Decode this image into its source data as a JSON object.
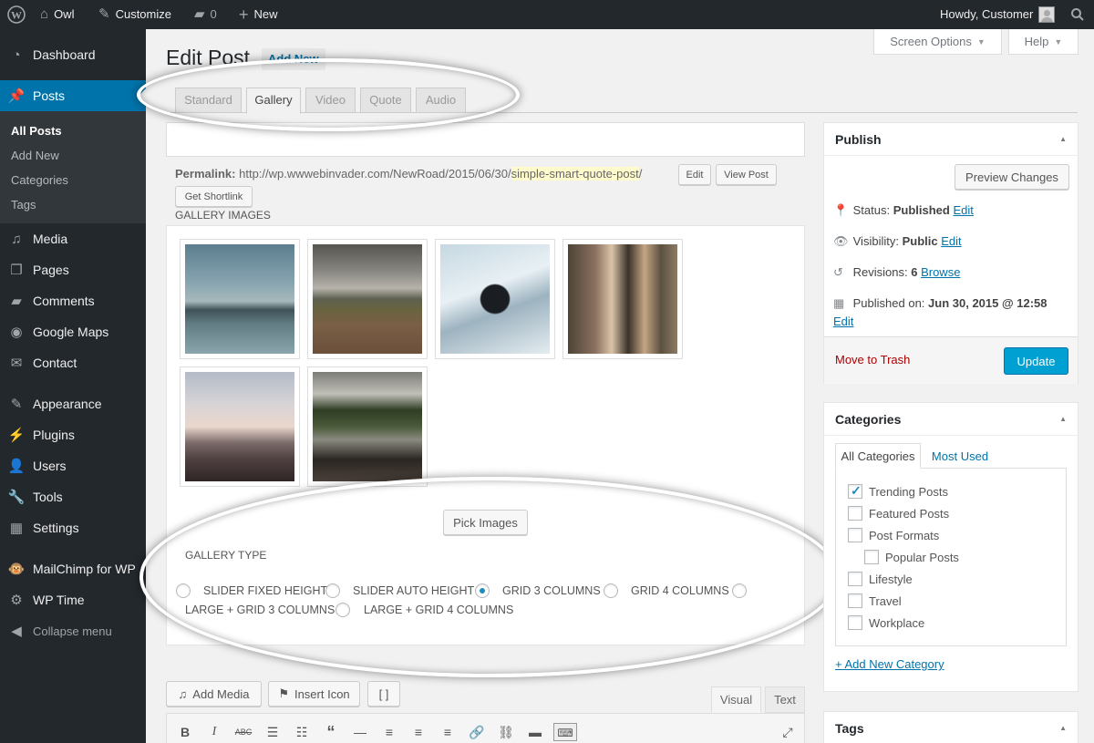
{
  "adminbar": {
    "site_name": "Owl",
    "customize": "Customize",
    "comments_count": "0",
    "new_label": "New",
    "howdy": "Howdy, Customer"
  },
  "sidebar": {
    "items": [
      {
        "label": "Dashboard",
        "icon": "dashboard-icon"
      },
      {
        "label": "Posts",
        "icon": "pushpin-icon"
      },
      {
        "label": "Media",
        "icon": "media-icon"
      },
      {
        "label": "Pages",
        "icon": "pages-icon"
      },
      {
        "label": "Comments",
        "icon": "comments-icon"
      },
      {
        "label": "Google Maps",
        "icon": "map-icon"
      },
      {
        "label": "Contact",
        "icon": "mail-icon"
      },
      {
        "label": "Appearance",
        "icon": "brush-icon"
      },
      {
        "label": "Plugins",
        "icon": "plugin-icon"
      },
      {
        "label": "Users",
        "icon": "user-icon"
      },
      {
        "label": "Tools",
        "icon": "wrench-icon"
      },
      {
        "label": "Settings",
        "icon": "settings-icon"
      },
      {
        "label": "MailChimp for WP",
        "icon": "mailchimp-icon"
      },
      {
        "label": "WP Time",
        "icon": "gear-icon"
      }
    ],
    "submenu": [
      "All Posts",
      "Add New",
      "Categories",
      "Tags"
    ],
    "collapse": "Collapse menu"
  },
  "screen_options": "Screen Options",
  "help": "Help",
  "page": {
    "title": "Edit Post",
    "add_new": "Add New"
  },
  "format_tabs": [
    "Standard",
    "Gallery",
    "Video",
    "Quote",
    "Audio"
  ],
  "active_format": "Gallery",
  "permalink": {
    "label": "Permalink:",
    "base": "http://wp.wwwebinvader.com/NewRoad/2015/06/30/",
    "slug": "simple-smart-quote-post",
    "trail": "/",
    "edit": "Edit",
    "view_post": "View Post",
    "get_shortlink": "Get Shortlink"
  },
  "gallery": {
    "label": "GALLERY IMAGES",
    "pick_images": "Pick Images",
    "type_label": "GALLERY TYPE",
    "types": [
      {
        "label": "SLIDER FIXED HEIGHT",
        "checked": false
      },
      {
        "label": "SLIDER AUTO HEIGHT",
        "checked": false
      },
      {
        "label": "GRID 3 COLUMNS",
        "checked": true
      },
      {
        "label": "GRID 4 COLUMNS",
        "checked": false
      },
      {
        "label": "LARGE + GRID 3 COLUMNS",
        "checked": false
      },
      {
        "label": "LARGE + GRID 4 COLUMNS",
        "checked": false
      }
    ]
  },
  "editor": {
    "add_media": "Add Media",
    "insert_icon": "Insert Icon",
    "shortcode": "[ ]",
    "visual_tab": "Visual",
    "text_tab": "Text"
  },
  "publish": {
    "title": "Publish",
    "preview": "Preview Changes",
    "status_label": "Status:",
    "status_value": "Published",
    "visibility_label": "Visibility:",
    "visibility_value": "Public",
    "revisions_label": "Revisions:",
    "revisions_value": "6",
    "browse": "Browse",
    "published_on_label": "Published on:",
    "published_on_value": "Jun 30, 2015 @ 12:58",
    "edit": "Edit",
    "trash": "Move to Trash",
    "update": "Update"
  },
  "categories": {
    "title": "Categories",
    "tab_all": "All Categories",
    "tab_used": "Most Used",
    "items": [
      {
        "label": "Trending Posts",
        "checked": true
      },
      {
        "label": "Featured Posts",
        "checked": false
      },
      {
        "label": "Post Formats",
        "checked": false
      },
      {
        "label": "Popular Posts",
        "checked": false
      },
      {
        "label": "Lifestyle",
        "checked": false
      },
      {
        "label": "Travel",
        "checked": false
      },
      {
        "label": "Workplace",
        "checked": false
      }
    ],
    "add_new": "+ Add New Category"
  },
  "tags": {
    "title": "Tags"
  },
  "colors": {
    "admin_dark": "#23282d",
    "accent": "#0073aa",
    "update_button": "#00a0d2",
    "trash": "#aa0000"
  }
}
